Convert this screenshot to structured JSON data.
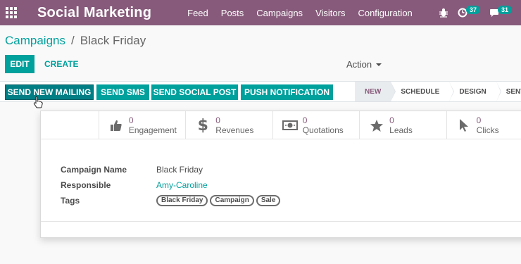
{
  "navbar": {
    "app_title": "Social Marketing",
    "menu": [
      "Feed",
      "Posts",
      "Campaigns",
      "Visitors",
      "Configuration"
    ],
    "activity_badge": "37",
    "messages_badge": "31"
  },
  "breadcrumb": {
    "parent": "Campaigns",
    "separator": "/",
    "current": "Black Friday"
  },
  "controls": {
    "edit": "EDIT",
    "create": "CREATE",
    "action": "Action"
  },
  "header": {
    "buttons": [
      "SEND NEW MAILING",
      "SEND SMS",
      "SEND SOCIAL POST",
      "PUSH NOTIFICATION"
    ],
    "stages": [
      "NEW",
      "SCHEDULE",
      "DESIGN",
      "SENT"
    ],
    "current_stage": "NEW"
  },
  "stats": [
    {
      "value": "0",
      "label": "Engagement",
      "icon": "thumbs-up-icon"
    },
    {
      "value": "0",
      "label": "Revenues",
      "icon": "dollar-icon"
    },
    {
      "value": "0",
      "label": "Quotations",
      "icon": "money-icon"
    },
    {
      "value": "0",
      "label": "Leads",
      "icon": "star-icon"
    },
    {
      "value": "0",
      "label": "Clicks",
      "icon": "pointer-icon"
    }
  ],
  "form": {
    "campaign_name_label": "Campaign Name",
    "campaign_name": "Black Friday",
    "responsible_label": "Responsible",
    "responsible": "Amy-Caroline",
    "tags_label": "Tags",
    "tags": [
      "Black Friday",
      "Campaign",
      "Sale"
    ]
  },
  "colors": {
    "brand": "#875a7b",
    "accent": "#00a09d"
  }
}
